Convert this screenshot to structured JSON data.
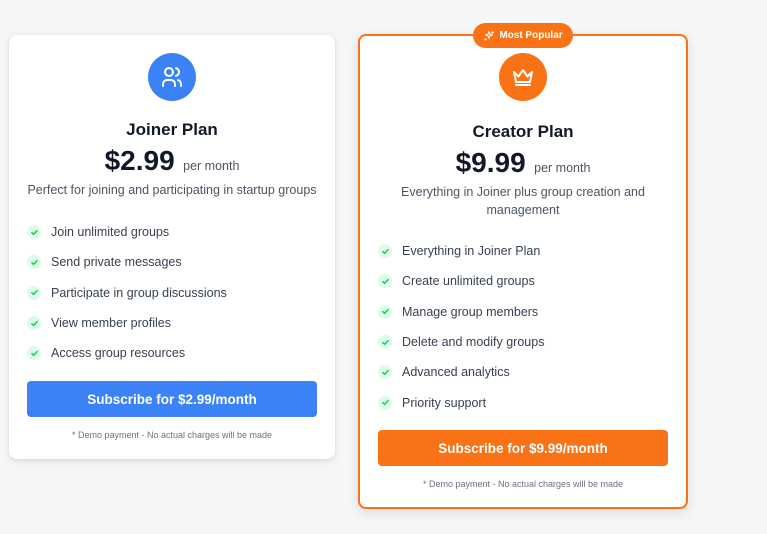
{
  "colors": {
    "joiner_accent": "#3b82f6",
    "creator_accent": "#f97316",
    "check_bg": "#dcfce7",
    "check_color": "#22c55e",
    "page_bg": "#f5f6f8"
  },
  "badge": {
    "label": "Most Popular",
    "icon": "sparkles-icon"
  },
  "plans": [
    {
      "icon": "users-icon",
      "title": "Joiner Plan",
      "price": "$2.99",
      "period": "per month",
      "description": "Perfect for joining and participating in startup groups",
      "features": [
        "Join unlimited groups",
        "Send private messages",
        "Participate in group discussions",
        "View member profiles",
        "Access group resources"
      ],
      "button_label": "Subscribe for $2.99/month",
      "note": "* Demo payment - No actual charges will be made"
    },
    {
      "icon": "crown-icon",
      "title": "Creator Plan",
      "price": "$9.99",
      "period": "per month",
      "description": "Everything in Joiner plus group creation and management",
      "features": [
        "Everything in Joiner Plan",
        "Create unlimited groups",
        "Manage group members",
        "Delete and modify groups",
        "Advanced analytics",
        "Priority support"
      ],
      "button_label": "Subscribe for $9.99/month",
      "note": "* Demo payment - No actual charges will be made"
    }
  ]
}
